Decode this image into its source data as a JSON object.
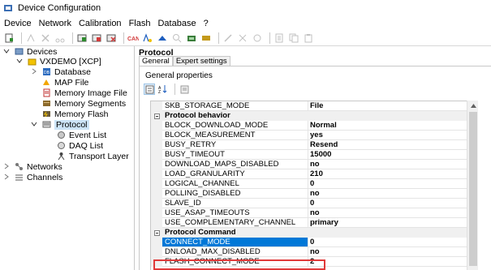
{
  "window": {
    "title": "Device Configuration",
    "icon": "device-config-icon"
  },
  "menu": [
    "Device",
    "Network",
    "Calibration",
    "Flash",
    "Database",
    "?"
  ],
  "toolbar": {
    "buttons": [
      {
        "icon": "new-device-icon",
        "enabled": true
      },
      {
        "icon": "new-network-icon",
        "enabled": false
      },
      {
        "icon": "delete-icon",
        "enabled": false
      },
      {
        "icon": "cut-icon",
        "enabled": false
      },
      {
        "icon": "add-device-icon",
        "enabled": true
      },
      {
        "icon": "remove-device-icon",
        "enabled": true
      },
      {
        "icon": "delete-device-icon",
        "enabled": true
      },
      {
        "icon": "can-icon",
        "enabled": true
      },
      {
        "icon": "a2l-icon",
        "enabled": true
      },
      {
        "icon": "calibration-icon",
        "enabled": true
      },
      {
        "icon": "search-icon",
        "enabled": false
      },
      {
        "icon": "flash-icon",
        "enabled": true
      },
      {
        "icon": "memory-icon",
        "enabled": true
      },
      {
        "icon": "connect-icon",
        "enabled": false
      },
      {
        "icon": "disconnect-icon",
        "enabled": false
      },
      {
        "icon": "properties-icon",
        "enabled": false
      },
      {
        "icon": "page-icon",
        "enabled": false
      },
      {
        "icon": "copy-icon",
        "enabled": false
      }
    ]
  },
  "tree": {
    "devices": "Devices",
    "device": "VXDEMO [XCP]",
    "children": [
      "Database",
      "MAP File",
      "Memory Image File",
      "Memory Segments",
      "Memory Flash",
      "Protocol"
    ],
    "protocol_children": [
      "Event List",
      "DAQ List",
      "Transport Layer"
    ],
    "networks": "Networks",
    "channels": "Channels"
  },
  "panel": {
    "header": "Protocol",
    "tabs": [
      "General",
      "Expert settings"
    ],
    "group_title": "General properties"
  },
  "properties": [
    {
      "type": "prop",
      "name": "SKB_STORAGE_MODE",
      "value": "File"
    },
    {
      "type": "cat",
      "name": "Protocol behavior"
    },
    {
      "type": "prop",
      "name": "BLOCK_DOWNLOAD_MODE",
      "value": "Normal"
    },
    {
      "type": "prop",
      "name": "BLOCK_MEASUREMENT",
      "value": "yes"
    },
    {
      "type": "prop",
      "name": "BUSY_RETRY",
      "value": "Resend"
    },
    {
      "type": "prop",
      "name": "BUSY_TIMEOUT",
      "value": "15000"
    },
    {
      "type": "prop",
      "name": "DOWNLOAD_MAPS_DISABLED",
      "value": "no"
    },
    {
      "type": "prop",
      "name": "LOAD_GRANULARITY",
      "value": "210"
    },
    {
      "type": "prop",
      "name": "LOGICAL_CHANNEL",
      "value": "0"
    },
    {
      "type": "prop",
      "name": "POLLING_DISABLED",
      "value": "no"
    },
    {
      "type": "prop",
      "name": "SLAVE_ID",
      "value": "0"
    },
    {
      "type": "prop",
      "name": "USE_ASAP_TIMEOUTS",
      "value": "no"
    },
    {
      "type": "prop",
      "name": "USE_COMPLEMENTARY_CHANNEL",
      "value": "primary"
    },
    {
      "type": "cat",
      "name": "Protocol Command"
    },
    {
      "type": "prop",
      "name": "CONNECT_MODE",
      "value": "0",
      "selected": true
    },
    {
      "type": "prop",
      "name": "DNLOAD_MAX_DISABLED",
      "value": "no"
    },
    {
      "type": "prop",
      "name": "FLASH_CONNECT_MODE",
      "value": "2",
      "highlighted": true
    }
  ],
  "colors": {
    "selection": "#0078d7",
    "tree_selection": "#cce4f7",
    "highlight_box": "#e03a3a"
  }
}
